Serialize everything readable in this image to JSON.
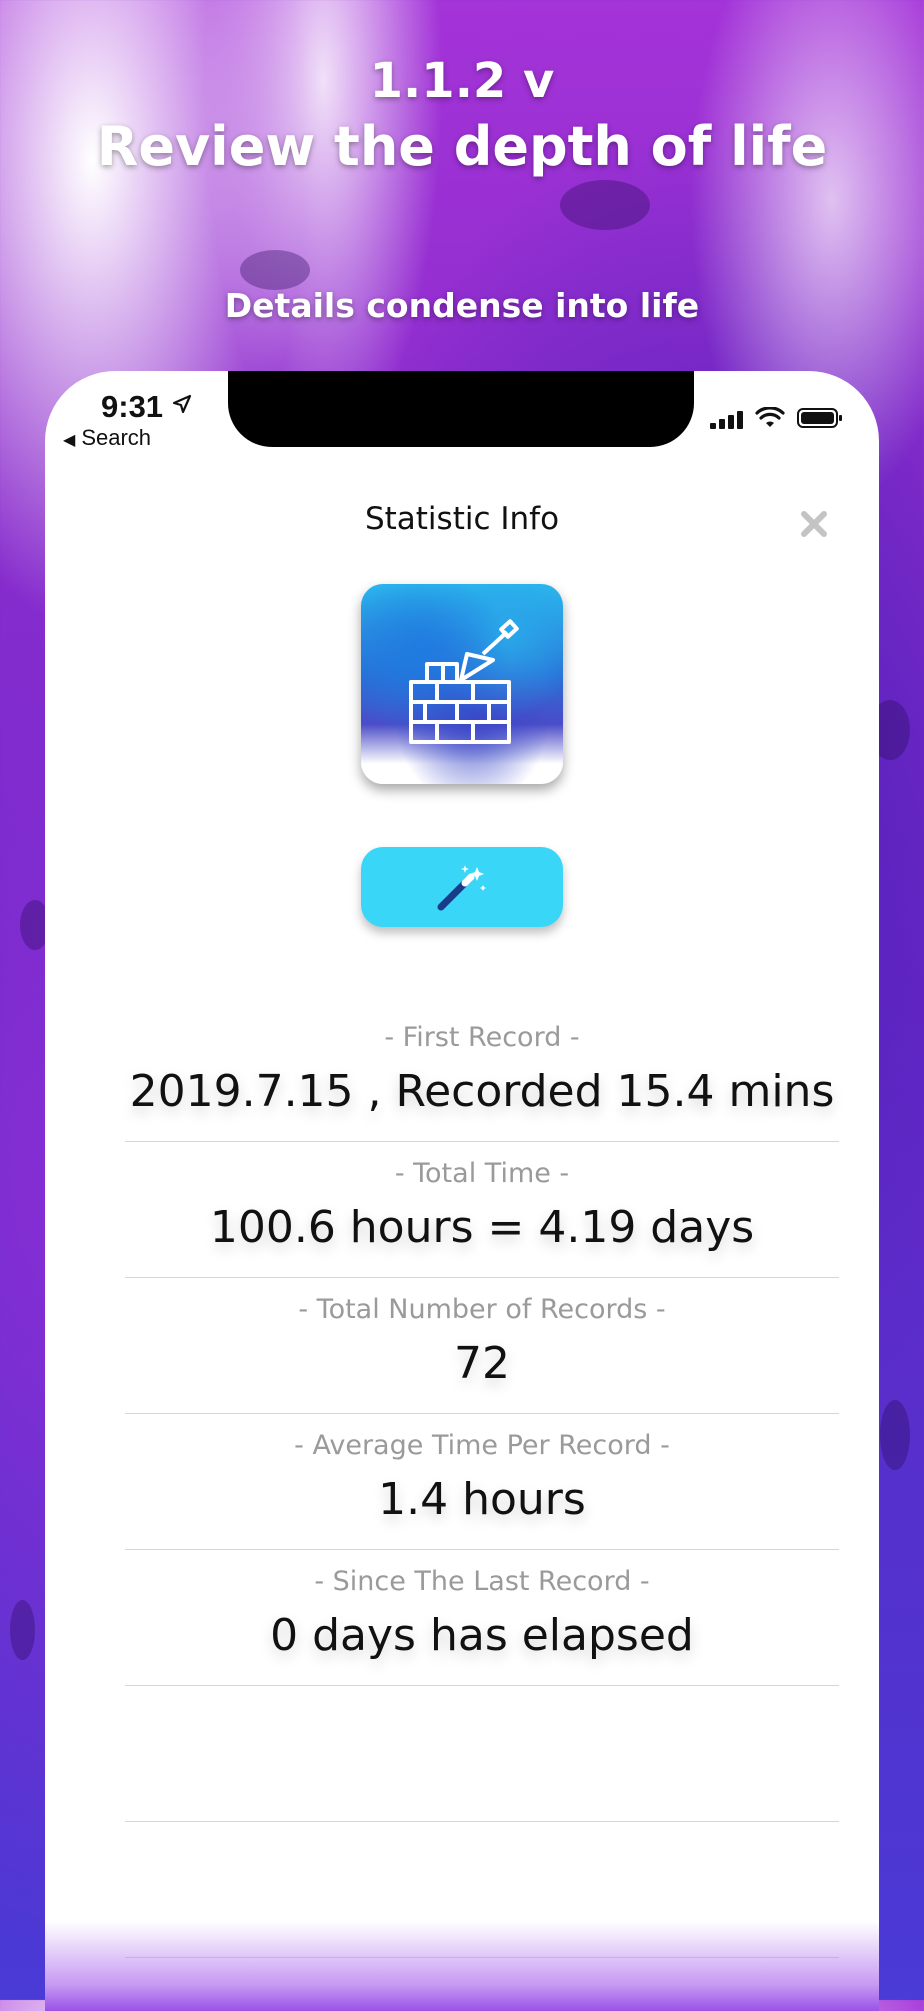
{
  "header": {
    "version": "1.1.2 v",
    "tagline": "Review the depth of life",
    "subtitle": "Details condense into life"
  },
  "status_bar": {
    "time": "9:31",
    "back_label": "Search"
  },
  "modal": {
    "title": "Statistic Info"
  },
  "stats": [
    {
      "label": "- First Record -",
      "value": "2019.7.15 , Recorded 15.4 mins"
    },
    {
      "label": "- Total Time -",
      "value": "100.6 hours = 4.19 days"
    },
    {
      "label": "- Total Number of Records -",
      "value": "72"
    },
    {
      "label": "- Average Time Per Record -",
      "value": "1.4 hours"
    },
    {
      "label": "- Since The Last Record -",
      "value": "0 days has elapsed"
    }
  ],
  "icons": {
    "app_icon": "brick-wall-trowel-icon",
    "magic_button": "magic-wand-icon",
    "close": "close-icon"
  },
  "colors": {
    "background_purple": "#8a2ccc",
    "accent_cyan": "#3ad6f8",
    "label_gray": "#9a9a9a"
  }
}
